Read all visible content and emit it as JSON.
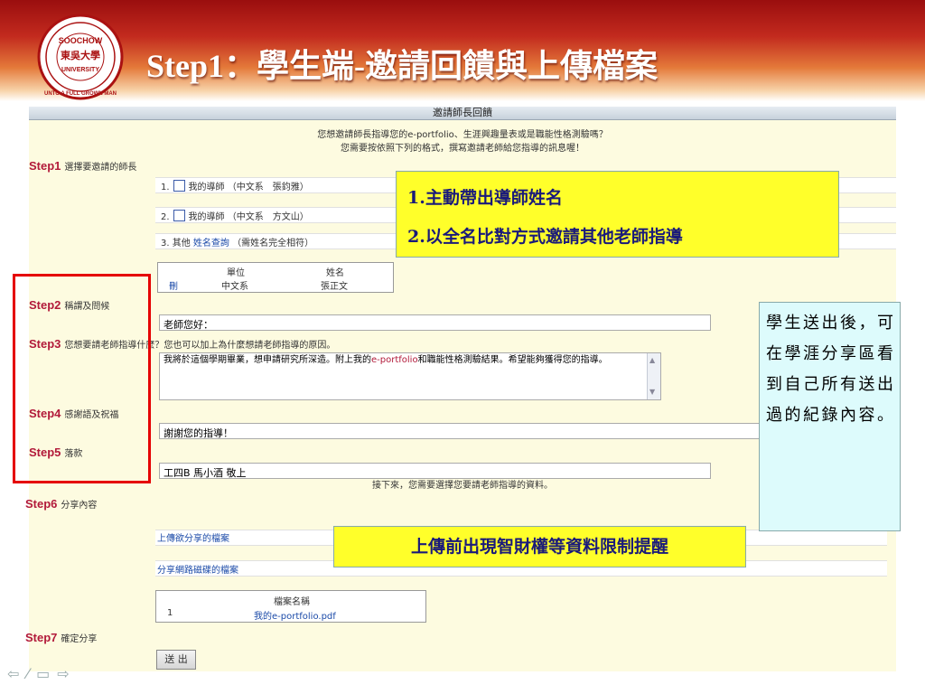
{
  "slide": {
    "title": "Step1：學生端-邀請回饋與上傳檔案"
  },
  "logo": {
    "text_top": "SOOCHOW",
    "text_mid": "東吳大學",
    "text_sub": "UNIVERSITY",
    "motto": "UNTO A FULL GROWN MAN"
  },
  "form": {
    "header": "邀請師長回饋",
    "intro_line1": "您想邀請師長指導您的e-portfolio、生涯興趣量表或是職能性格測驗嗎？",
    "intro_line2": "您需要按依照下列的格式，撰寫邀請老師給您指導的訊息喔！",
    "step1": {
      "label": "Step1",
      "text": "選擇要邀請的師長"
    },
    "option1": {
      "num": "1.",
      "text": "我的導師 （中文系　張鈞雅）"
    },
    "option2": {
      "num": "2.",
      "text": "我的導師 （中文系　方文山）"
    },
    "option3": {
      "num": "3. 其他",
      "link": "姓名查詢",
      "note": "（需姓名完全相符）"
    },
    "teacher_table": {
      "headers": [
        "單位",
        "姓名"
      ],
      "row": {
        "action": "刪",
        "unit": "中文系",
        "name": "張正文"
      }
    },
    "step2": {
      "label": "Step2",
      "text": "稱謂及問候"
    },
    "greeting_value": "老師您好：",
    "step3": {
      "label": "Step3",
      "text": "您想要請老師指導什麼？您也可以加上為什麼想請老師指導的原因。"
    },
    "message_value_1": "我將於這個學期畢業，想申請研究所深造。附上我的",
    "message_link": "e-portfolio",
    "message_value_2": "和職能性格測驗結果。希望能夠獲得您的指導。",
    "step4": {
      "label": "Step4",
      "text": "感謝語及祝福"
    },
    "thanks_value": "謝謝您的指導！",
    "step5": {
      "label": "Step5",
      "text": "落款"
    },
    "signature_value": "工四B 馬小酒 敬上",
    "next_note": "接下來，您需要選擇您要請老師指導的資料。",
    "step6": {
      "label": "Step6",
      "text": "分享內容"
    },
    "share_files": "上傳欲分享的檔案",
    "share_disk": "分享網路磁碟的檔案",
    "file_table": {
      "header": "檔案名稱",
      "row": {
        "num": "1",
        "name": "我的e-portfolio.pdf"
      }
    },
    "step7": {
      "label": "Step7",
      "text": "確定分享"
    },
    "submit_label": "送 出"
  },
  "callouts": {
    "yellow_line1": "1.主動帶出導師姓名",
    "yellow_line2": "2.以全名比對方式邀請其他老師指導",
    "cyan_text": "學生送出後，可在學涯分享區看到自己所有送出過的紀錄內容。",
    "upload_note": "上傳前出現智財權等資料限制提醒"
  },
  "nav": {
    "icons": [
      "back-arrow-icon",
      "pen-icon",
      "menu-icon",
      "forward-arrow-icon"
    ]
  },
  "colors": {
    "step_label": "#b21a3a",
    "callout_yellow": "#ffff2a",
    "callout_cyan": "#ddfbfc",
    "frame_red": "#e50000",
    "link": "#1b4aa8"
  }
}
